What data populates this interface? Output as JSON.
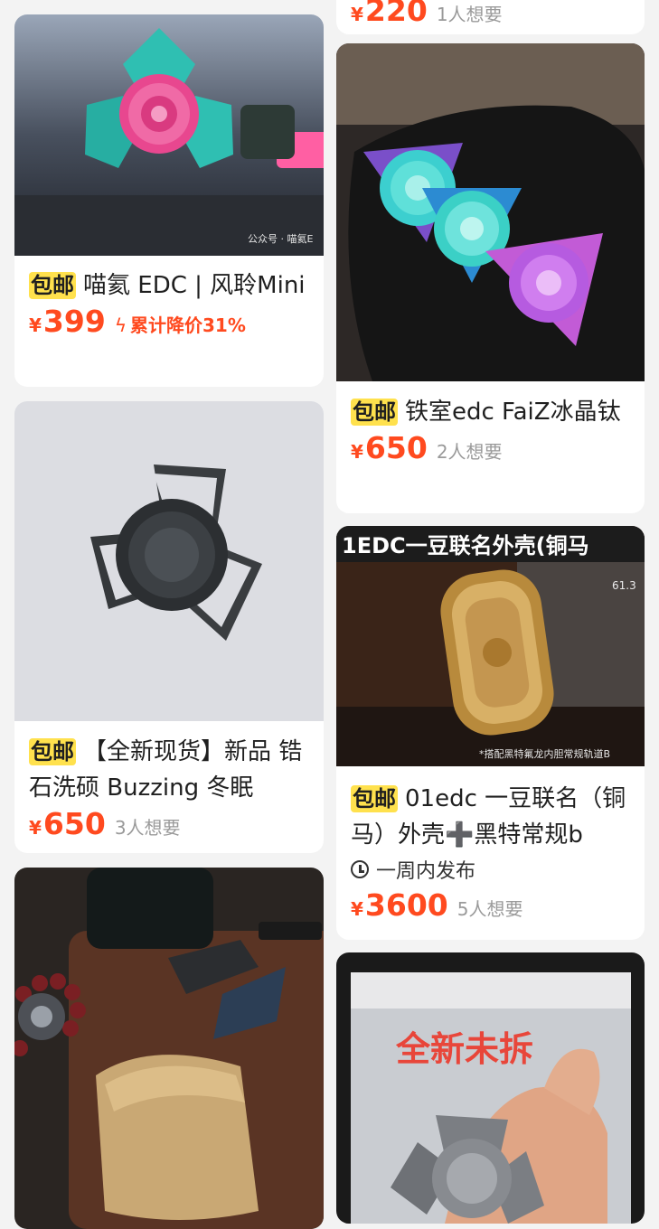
{
  "products": [
    {
      "tag": "包邮",
      "title": "喵氦 EDC | 风聆Mini",
      "price_symbol": "¥",
      "price": "399",
      "price_drop": "累计降价31%",
      "watermark": "公众号 · 喵氦E"
    },
    {
      "tag": "包邮",
      "title": "【全新现货】新品 锆石洗硕 Buzzing 冬眠",
      "price_symbol": "¥",
      "price": "650",
      "wants": "3人想要"
    },
    {
      "tag": "包邮",
      "title": "铁室edc FaiZ冰晶钛",
      "price_symbol": "¥",
      "price": "650",
      "wants": "2人想要"
    },
    {
      "tag": "包邮",
      "title": "01edc 一豆联名（铜马）外壳➕黑特常规b",
      "meta": "一周内发布",
      "price_symbol": "¥",
      "price": "3600",
      "wants": "5人想要",
      "image_banner": "1EDC一豆联名外壳(铜马",
      "image_caption": "*搭配黑特氟龙内胆常规轨道B",
      "image_size_label": "61.3"
    },
    {
      "overlay_text": "全新未拆"
    }
  ],
  "top_partial": {
    "price_symbol": "¥",
    "price": "220",
    "wants": "1人想要"
  }
}
